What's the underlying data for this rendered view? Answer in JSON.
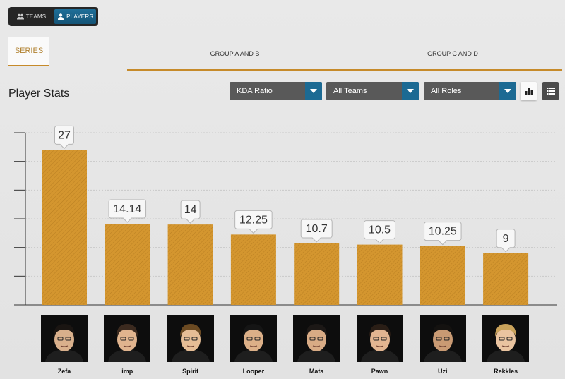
{
  "toggle": {
    "teams_label": "TEAMS",
    "players_label": "PLAYERS",
    "active": "players"
  },
  "tabs": {
    "series": "SERIES",
    "group_ab": "GROUP A AND B",
    "group_cd": "GROUP C AND D"
  },
  "title": "Player Stats",
  "filters": {
    "stat": "KDA Ratio",
    "teams": "All Teams",
    "roles": "All Roles"
  },
  "colors": {
    "accent": "#c68a2a",
    "bar": "#d4962f",
    "dropdown": "#595959",
    "dropdown_arrow": "#1c6a93"
  },
  "icons": {
    "teams": "group-icon",
    "players": "user-icon",
    "chart_view": "bar-chart-icon",
    "list_view": "list-icon",
    "dropdown": "chevron-down-icon"
  },
  "chart_data": {
    "type": "bar",
    "title": "",
    "xlabel": "",
    "ylabel": "",
    "categories": [
      "Zefa",
      "imp",
      "Spirit",
      "Looper",
      "Mata",
      "Pawn",
      "Uzi",
      "Rekkles"
    ],
    "values": [
      27,
      14.14,
      14,
      12.25,
      10.7,
      10.5,
      10.25,
      9
    ],
    "data_labels": [
      "27",
      "14.14",
      "14",
      "12.25",
      "10.7",
      "10.5",
      "10.25",
      "9"
    ],
    "ylim": [
      0,
      30
    ],
    "grid": true,
    "y_tick_labels": false
  },
  "players": [
    {
      "name": "Zefa"
    },
    {
      "name": "imp"
    },
    {
      "name": "Spirit"
    },
    {
      "name": "Looper"
    },
    {
      "name": "Mata"
    },
    {
      "name": "Pawn"
    },
    {
      "name": "Uzi"
    },
    {
      "name": "Rekkles"
    }
  ]
}
